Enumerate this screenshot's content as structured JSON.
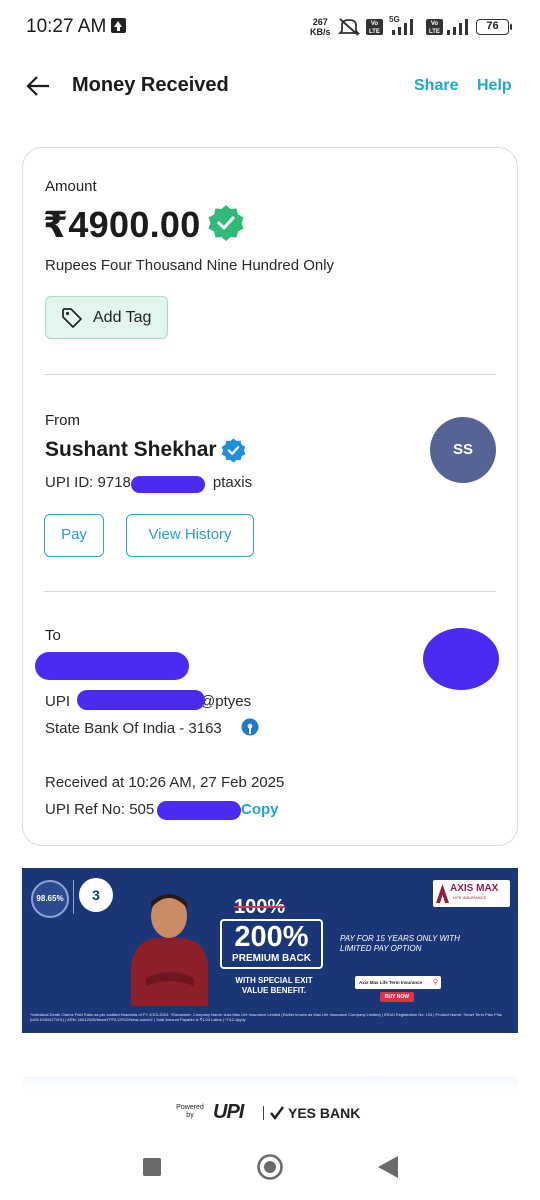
{
  "status_bar": {
    "time": "10:27 AM",
    "net_speed_value": "267",
    "net_speed_unit": "KB/s",
    "volte_label": "Vo LTE",
    "network_5g": "5G",
    "battery": "76"
  },
  "header": {
    "title": "Money Received",
    "share_label": "Share",
    "help_label": "Help"
  },
  "amount_section": {
    "label": "Amount",
    "value": "₹4900.00",
    "in_words": "Rupees Four Thousand Nine Hundred Only",
    "add_tag_label": "Add Tag"
  },
  "from_section": {
    "label": "From",
    "name": "Sushant Shekhar",
    "upi_prefix": "UPI ID: 9718",
    "upi_suffix": "ptaxis",
    "avatar_initials": "SS",
    "pay_label": "Pay",
    "view_history_label": "View History"
  },
  "to_section": {
    "label": "To",
    "upi_prefix": "UPI",
    "upi_suffix": "@ptyes",
    "bank": "State Bank Of India - 3163",
    "received_at": "Received at 10:26 AM, 27 Feb 2025",
    "ref_prefix": "UPI Ref No: 505",
    "copy_label": "Copy"
  },
  "ad": {
    "badge_percent": "98.65%",
    "badge_number": "3",
    "strike_text": "100%",
    "big_text": "200%",
    "big_sub": "PREMIUM BACK",
    "exit_text": "WITH SPECIAL EXIT VALUE BENEFIT.",
    "pay_text": "PAY FOR 15 YEARS ONLY WITH LIMITED PAY OPTION",
    "logo_text": "AXIS MAX",
    "logo_sub": "LIFE INSURANCE",
    "search_text": "Axis Max Life Term Insurance",
    "buy_label": "BUY NOW",
    "fine_print": "*Individual Death Claims Paid Ratio as per audited financials of FY 2023-2024. *Disclaimer: Company Name: Axis Max Life Insurance Limited (Earlier known as Max Life Insurance Company Limited) | IRDAI Registration No: 104 | Product Name: Smart Term Plan Plus (UIN:104N127V01) | ARN: 16012025/NewsTFP/LCRS2/NewLaunch2 | Total Amount Payable is ₹1.04 Lakhs | *T&C Apply"
  },
  "footer": {
    "powered_by": "Powered by",
    "upi_logo": "UPI",
    "bank": "YES BANK"
  },
  "colors": {
    "accent": "#22a7c9",
    "verified_green": "#2fba78",
    "verified_blue": "#1e8fe1",
    "redaction": "#4b2bf2",
    "avatar": "#566395",
    "ad_background": "#1b3677"
  }
}
